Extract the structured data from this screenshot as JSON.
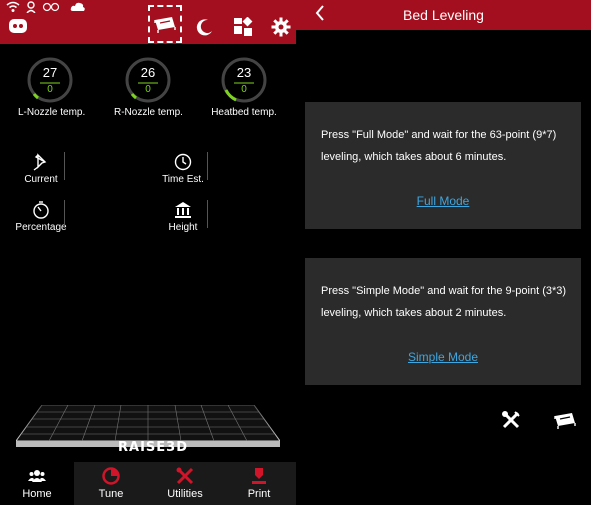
{
  "left": {
    "gauges": [
      {
        "value": "27",
        "target": "0",
        "label": "L-Nozzle temp."
      },
      {
        "value": "26",
        "target": "0",
        "label": "R-Nozzle temp."
      },
      {
        "value": "23",
        "target": "0",
        "label": "Heatbed temp."
      }
    ],
    "stats": [
      {
        "label": "Current"
      },
      {
        "label": "Time Est."
      },
      {
        "label": "Percentage"
      },
      {
        "label": "Height"
      }
    ],
    "brand": "RAISE3D",
    "nav": [
      {
        "label": "Home"
      },
      {
        "label": "Tune"
      },
      {
        "label": "Utilities"
      },
      {
        "label": "Print"
      }
    ]
  },
  "right": {
    "title": "Bed Leveling",
    "full_mode": {
      "description": "Press \"Full Mode\" and wait for the 63-point (9*7) leveling, which takes about 6 minutes.",
      "link": "Full Mode"
    },
    "simple_mode": {
      "description": "Press \"Simple Mode\" and wait for the 9-point (3*3) leveling, which takes about 2 minutes.",
      "link": "Simple Mode"
    }
  },
  "colors": {
    "topbar": "#a30f1e",
    "accent_green": "#7ed321",
    "link_blue": "#3ea6e0",
    "card": "#2b2b2b"
  }
}
